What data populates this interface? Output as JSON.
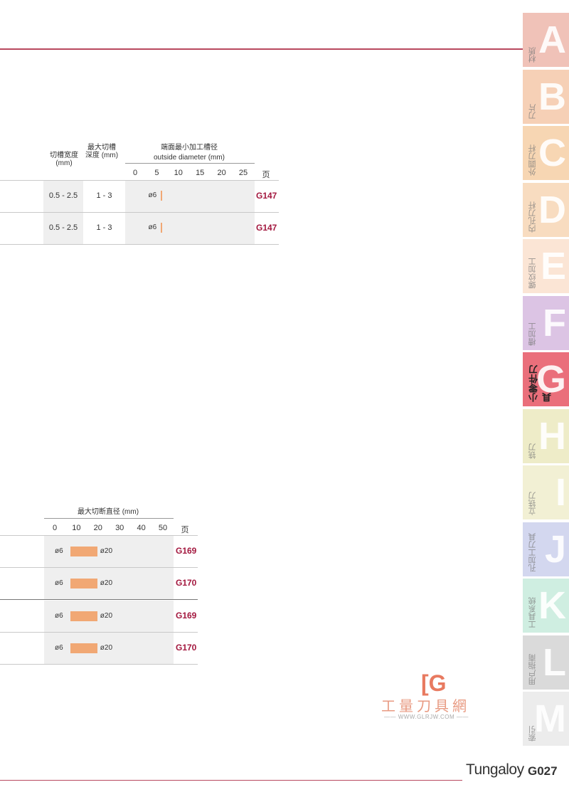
{
  "footer": {
    "brand": "Tungaloy",
    "page": "G027"
  },
  "tabs": [
    {
      "letter": "A",
      "label": "材质",
      "color": "#f0c2b8"
    },
    {
      "letter": "B",
      "label": "刀片",
      "color": "#f6d0b6"
    },
    {
      "letter": "C",
      "label": "外圆刀杆",
      "color": "#f7d6b3"
    },
    {
      "letter": "D",
      "label": "内孔刀杆",
      "color": "#f8dcc0"
    },
    {
      "letter": "E",
      "label": "螺纹加工",
      "color": "#fbe5d5"
    },
    {
      "letter": "F",
      "label": "槽加工",
      "color": "#dcc4e4"
    },
    {
      "letter": "G",
      "label": "小零件刀具",
      "color": "#ea6f7b",
      "active": true
    },
    {
      "letter": "H",
      "label": "铣刀",
      "color": "#eeecc8"
    },
    {
      "letter": "I",
      "label": "立铣刀",
      "color": "#f2f0d4"
    },
    {
      "letter": "J",
      "label": "孔加工刀具",
      "color": "#d3d7ef"
    },
    {
      "letter": "K",
      "label": "工具系统",
      "color": "#cfeee1"
    },
    {
      "letter": "L",
      "label": "用户指南",
      "color": "#dadada"
    },
    {
      "letter": "M",
      "label": "索引",
      "color": "#ececec"
    }
  ],
  "table1": {
    "col_width": "切槽宽度\n(mm)",
    "col_depth": "最大切槽\n深度 (mm)",
    "col_diam_cn": "端面最小加工槽径",
    "col_diam_en": "outside diameter (mm)",
    "ticks": [
      "0",
      "5",
      "10",
      "15",
      "20",
      "25"
    ],
    "col_page": "页",
    "rows": [
      {
        "width": "0.5 - 2.5",
        "depth": "1 - 3",
        "min_label": "ø6",
        "min": 6,
        "page": "G147"
      },
      {
        "width": "0.5 - 2.5",
        "depth": "1 - 3",
        "min_label": "ø6",
        "min": 6,
        "page": "G147"
      }
    ]
  },
  "table2": {
    "header": "最大切断直径 (mm)",
    "ticks": [
      "0",
      "10",
      "20",
      "30",
      "40",
      "50"
    ],
    "col_page": "页",
    "rows": [
      {
        "from_label": "ø6",
        "to_label": "ø20",
        "from": 6,
        "to": 20,
        "page": "G169"
      },
      {
        "from_label": "ø6",
        "to_label": "ø20",
        "from": 6,
        "to": 20,
        "page": "G170"
      },
      {
        "from_label": "ø6",
        "to_label": "ø20",
        "from": 6,
        "to": 20,
        "page": "G169"
      },
      {
        "from_label": "ø6",
        "to_label": "ø20",
        "from": 6,
        "to": 20,
        "page": "G170"
      }
    ]
  },
  "watermark": {
    "mark": "[G",
    "cn": "工量刀具網",
    "url": "—— WWW.GLRJW.COM ——"
  }
}
